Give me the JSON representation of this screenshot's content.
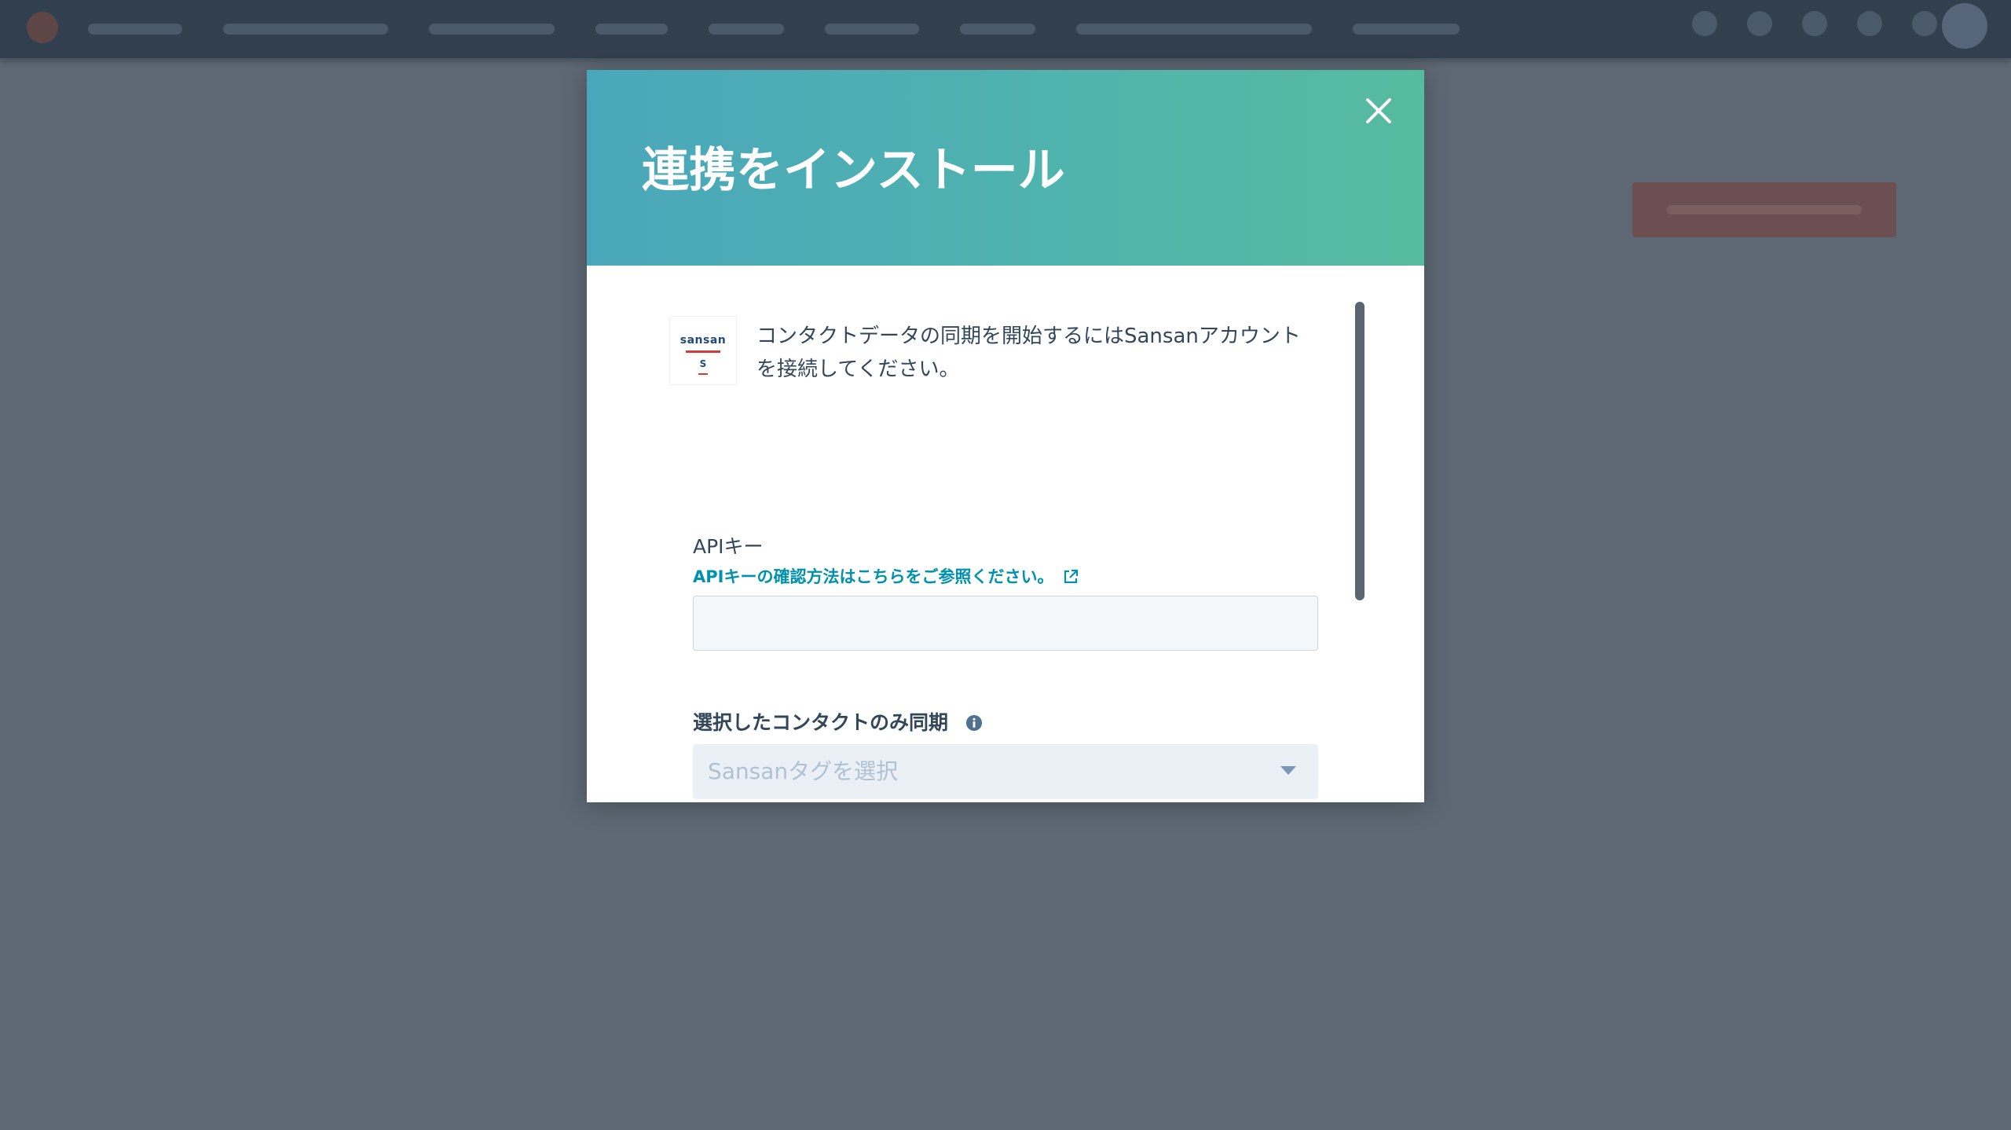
{
  "modal": {
    "title": "連携をインストール",
    "close_icon": "close-icon",
    "intro_text": "コンタクトデータの同期を開始するにはSansanアカウントを接続してください。",
    "logo": {
      "word": "sansan",
      "mark": "S"
    },
    "api_key": {
      "label": "APIキー",
      "help_link": "APIキーの確認方法はこちらをご参照ください。",
      "help_icon": "external-link-icon",
      "value": "",
      "placeholder": ""
    },
    "sync": {
      "label": "選択したコンタクトのみ同期",
      "info_icon": "info-icon",
      "placeholder": "Sansanタグを選択"
    }
  },
  "colors": {
    "header_start": "#4aa7bb",
    "header_end": "#57bba0",
    "link": "#0091ae",
    "text": "#33475b",
    "overlay": "#5d6874"
  }
}
